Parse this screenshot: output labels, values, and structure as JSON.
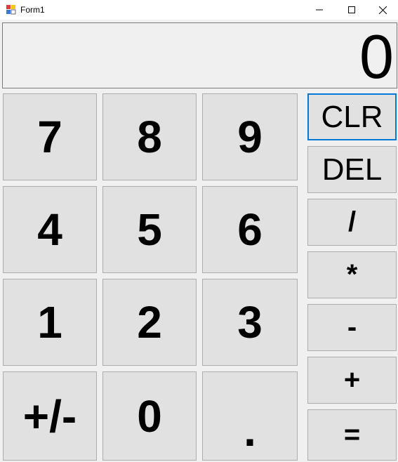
{
  "window": {
    "title": "Form1"
  },
  "display": {
    "value": "0"
  },
  "keypad": [
    {
      "name": "key-7",
      "label": "7"
    },
    {
      "name": "key-8",
      "label": "8"
    },
    {
      "name": "key-9",
      "label": "9"
    },
    {
      "name": "key-4",
      "label": "4"
    },
    {
      "name": "key-5",
      "label": "5"
    },
    {
      "name": "key-6",
      "label": "6"
    },
    {
      "name": "key-1",
      "label": "1"
    },
    {
      "name": "key-2",
      "label": "2"
    },
    {
      "name": "key-3",
      "label": "3"
    },
    {
      "name": "key-plus-minus",
      "label": "+/-"
    },
    {
      "name": "key-0",
      "label": "0"
    },
    {
      "name": "key-decimal",
      "label": "."
    }
  ],
  "operators": [
    {
      "name": "clear-button",
      "label": "CLR"
    },
    {
      "name": "delete-button",
      "label": "DEL"
    },
    {
      "name": "divide-button",
      "label": "/"
    },
    {
      "name": "multiply-button",
      "label": "*"
    },
    {
      "name": "subtract-button",
      "label": "-"
    },
    {
      "name": "add-button",
      "label": "+"
    },
    {
      "name": "equals-button",
      "label": "="
    }
  ],
  "icons": {
    "app": "form-app-icon",
    "minimize": "minimize-icon",
    "maximize": "maximize-icon",
    "close": "close-icon"
  }
}
